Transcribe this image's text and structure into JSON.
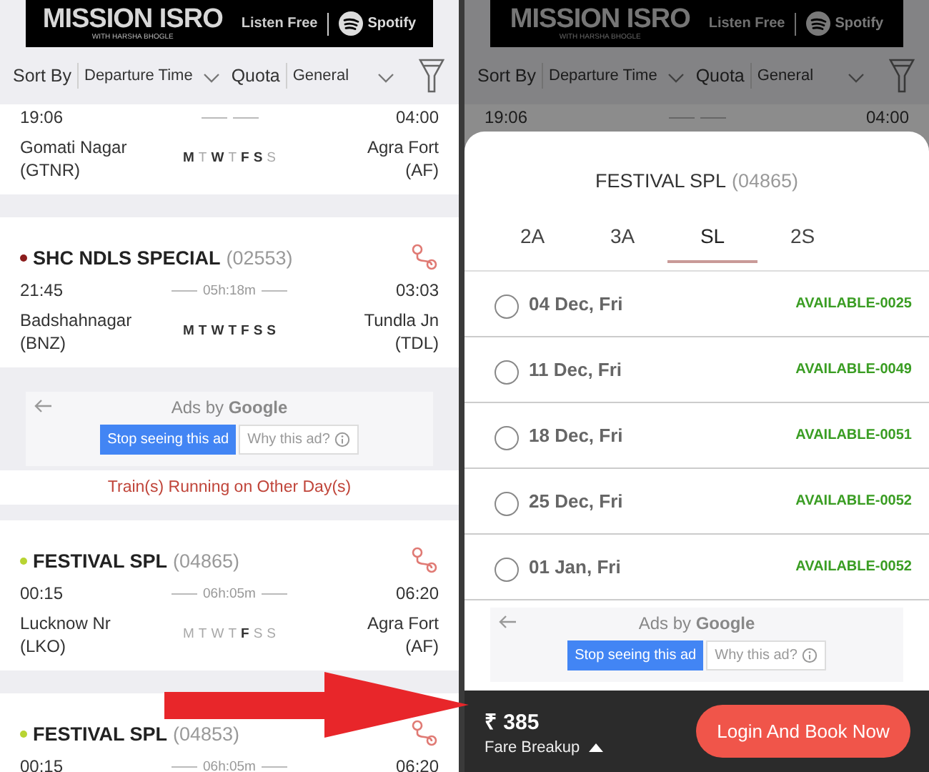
{
  "screens": [
    {
      "ad_banner": {
        "title": "MISSION ISRO",
        "subtitle": "WITH HARSHA BHOGLE",
        "cta": "Listen Free",
        "brand": "Spotify"
      },
      "sort_bar": {
        "sort_label": "Sort By",
        "sort_value": "Departure Time",
        "quota_label": "Quota",
        "quota_value": "General"
      },
      "list": [
        {
          "kind": "train",
          "departure": "19:06",
          "arrival": "04:00",
          "from": "Gomati Nagar",
          "from_code": "(GTNR)",
          "to": "Agra Fort",
          "to_code": "(AF)",
          "days": [
            {
              "letter": "M",
              "runs": true
            },
            {
              "letter": "T",
              "runs": false
            },
            {
              "letter": "W",
              "runs": true
            },
            {
              "letter": "T",
              "runs": false
            },
            {
              "letter": "F",
              "runs": true
            },
            {
              "letter": "S",
              "runs": true
            },
            {
              "letter": "S",
              "runs": false
            }
          ]
        },
        {
          "kind": "train",
          "name": "SHC NDLS SPECIAL",
          "number": "(02553)",
          "color": "#8b1c1c",
          "departure": "21:45",
          "duration": "05h:18m",
          "arrival": "03:03",
          "from": "Badshahnagar",
          "from_code": "(BNZ)",
          "to": "Tundla Jn",
          "to_code": "(TDL)",
          "days": [
            {
              "letter": "M",
              "runs": true
            },
            {
              "letter": "T",
              "runs": true
            },
            {
              "letter": "W",
              "runs": true
            },
            {
              "letter": "T",
              "runs": true
            },
            {
              "letter": "F",
              "runs": true
            },
            {
              "letter": "S",
              "runs": true
            },
            {
              "letter": "S",
              "runs": true
            }
          ]
        },
        {
          "kind": "ad",
          "label": "Ads by **Google**",
          "stop_button": "Stop seeing this ad",
          "why_button": "Why this ad?"
        },
        {
          "kind": "heading",
          "text": "Train(s) Running on Other Day(s)"
        },
        {
          "kind": "train",
          "name": "FESTIVAL SPL",
          "number": "(04865)",
          "color": "#b8d432",
          "departure": "00:15",
          "duration": "06h:05m",
          "arrival": "06:20",
          "from": "Lucknow Nr",
          "from_code": "(LKO)",
          "to": "Agra Fort",
          "to_code": "(AF)",
          "days": [
            {
              "letter": "M",
              "runs": false
            },
            {
              "letter": "T",
              "runs": false
            },
            {
              "letter": "W",
              "runs": false
            },
            {
              "letter": "T",
              "runs": false
            },
            {
              "letter": "F",
              "runs": true
            },
            {
              "letter": "S",
              "runs": false
            },
            {
              "letter": "S",
              "runs": false
            }
          ]
        },
        {
          "kind": "train",
          "name": "FESTIVAL SPL",
          "number": "(04853)",
          "color": "#b8d432",
          "departure": "00:15",
          "duration": "06h:05m",
          "arrival": "06:20"
        }
      ]
    },
    {
      "ad_banner": {
        "title": "MISSION ISRO",
        "subtitle": "WITH HARSHA BHOGLE",
        "cta": "Listen Free",
        "brand": "Spotify"
      },
      "sort_bar": {
        "sort_label": "Sort By",
        "sort_value": "Departure Time",
        "quota_label": "Quota",
        "quota_value": "General"
      },
      "list": [
        {
          "kind": "train",
          "departure": "19:06",
          "arrival": "04:00"
        }
      ],
      "sheet": {
        "train_name": "FESTIVAL SPL",
        "train_number": "(04865)",
        "classes": [
          {
            "label": "2A",
            "selected": false
          },
          {
            "label": "3A",
            "selected": false
          },
          {
            "label": "SL",
            "selected": true
          },
          {
            "label": "2S",
            "selected": false
          }
        ],
        "dates": [
          {
            "date": "04 Dec, Fri",
            "status": "AVAILABLE-0025",
            "selected": false
          },
          {
            "date": "11 Dec, Fri",
            "status": "AVAILABLE-0049",
            "selected": false
          },
          {
            "date": "18 Dec, Fri",
            "status": "AVAILABLE-0051",
            "selected": false
          },
          {
            "date": "25 Dec, Fri",
            "status": "AVAILABLE-0052",
            "selected": false
          },
          {
            "date": "01 Jan, Fri",
            "status": "AVAILABLE-0052",
            "selected": false
          }
        ],
        "ad": {
          "label": "Ads by **Google**",
          "stop_button": "Stop seeing this ad",
          "why_button": "Why this ad?"
        },
        "fare": "₹ 385",
        "fare_breakup": "Fare Breakup",
        "book_button": "Login And Book Now"
      }
    }
  ]
}
